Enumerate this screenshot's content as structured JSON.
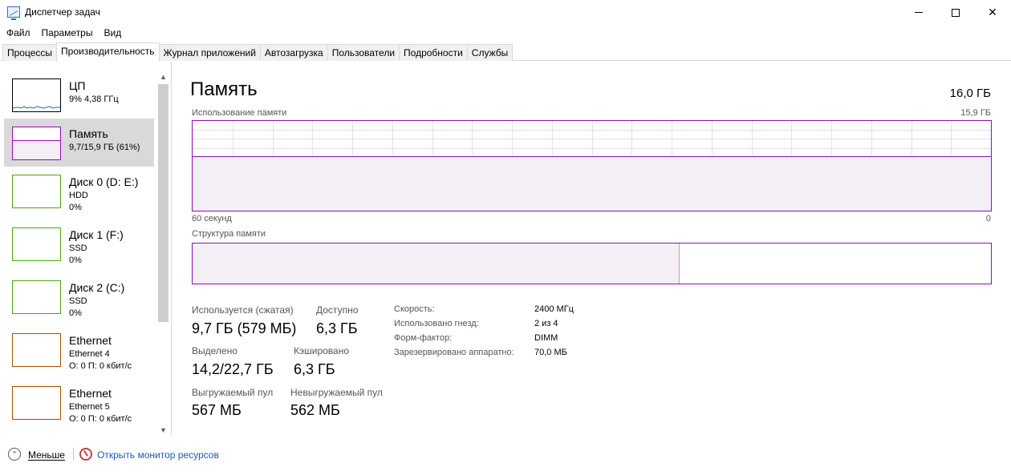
{
  "window": {
    "title": "Диспетчер задач"
  },
  "menu": [
    "Файл",
    "Параметры",
    "Вид"
  ],
  "tabs": [
    {
      "label": "Процессы",
      "active": false
    },
    {
      "label": "Производительность",
      "active": true
    },
    {
      "label": "Журнал приложений",
      "active": false
    },
    {
      "label": "Автозагрузка",
      "active": false
    },
    {
      "label": "Пользователи",
      "active": false
    },
    {
      "label": "Подробности",
      "active": false
    },
    {
      "label": "Службы",
      "active": false
    }
  ],
  "sidebar": {
    "items": [
      {
        "title": "ЦП",
        "line1": "9%  4,38 ГГц",
        "line2": "",
        "color": "#1173ba",
        "selected": false
      },
      {
        "title": "Память",
        "line1": "9,7/15,9 ГБ (61%)",
        "line2": "",
        "color": "#8b12ae",
        "selected": true
      },
      {
        "title": "Диск 0 (D: E:)",
        "line1": "HDD",
        "line2": "0%",
        "color": "#4da60c",
        "selected": false
      },
      {
        "title": "Диск 1 (F:)",
        "line1": "SSD",
        "line2": "0%",
        "color": "#4da60c",
        "selected": false
      },
      {
        "title": "Диск 2 (C:)",
        "line1": "SSD",
        "line2": "0%",
        "color": "#4da60c",
        "selected": false
      },
      {
        "title": "Ethernet",
        "line1": "Ethernet 4",
        "line2": "О: 0 П: 0 кбит/с",
        "color": "#a74f01",
        "selected": false
      },
      {
        "title": "Ethernet",
        "line1": "Ethernet 5",
        "line2": "О: 0 П: 0 кбит/с",
        "color": "#a74f01",
        "selected": false
      }
    ]
  },
  "memory": {
    "title": "Память",
    "total": "16,0 ГБ",
    "usage_label": "Использование памяти",
    "usage_max": "15,9 ГБ",
    "usage_fraction": 0.61,
    "axis_left": "60 секунд",
    "axis_right": "0",
    "composition_label": "Структура памяти",
    "composition_used_fraction": 0.61,
    "accent": "#8b12ae",
    "stats": {
      "in_use_label": "Используется (сжатая)",
      "in_use_value": "9,7 ГБ (579 МБ)",
      "available_label": "Доступно",
      "available_value": "6,3 ГБ",
      "committed_label": "Выделено",
      "committed_value": "14,2/22,7 ГБ",
      "cached_label": "Кэшировано",
      "cached_value": "6,3 ГБ",
      "paged_label": "Выгружаемый пул",
      "paged_value": "567 МБ",
      "nonpaged_label": "Невыгружаемый пул",
      "nonpaged_value": "562 МБ"
    },
    "info": [
      {
        "label": "Скорость:",
        "value": "2400 МГц"
      },
      {
        "label": "Использовано гнезд:",
        "value": "2 из 4"
      },
      {
        "label": "Форм-фактор:",
        "value": "DIMM"
      },
      {
        "label": "Зарезервировано аппаратно:",
        "value": "70,0 МБ"
      }
    ]
  },
  "footer": {
    "less_label": "Меньше",
    "monitor_label": "Открыть монитор ресурсов"
  }
}
